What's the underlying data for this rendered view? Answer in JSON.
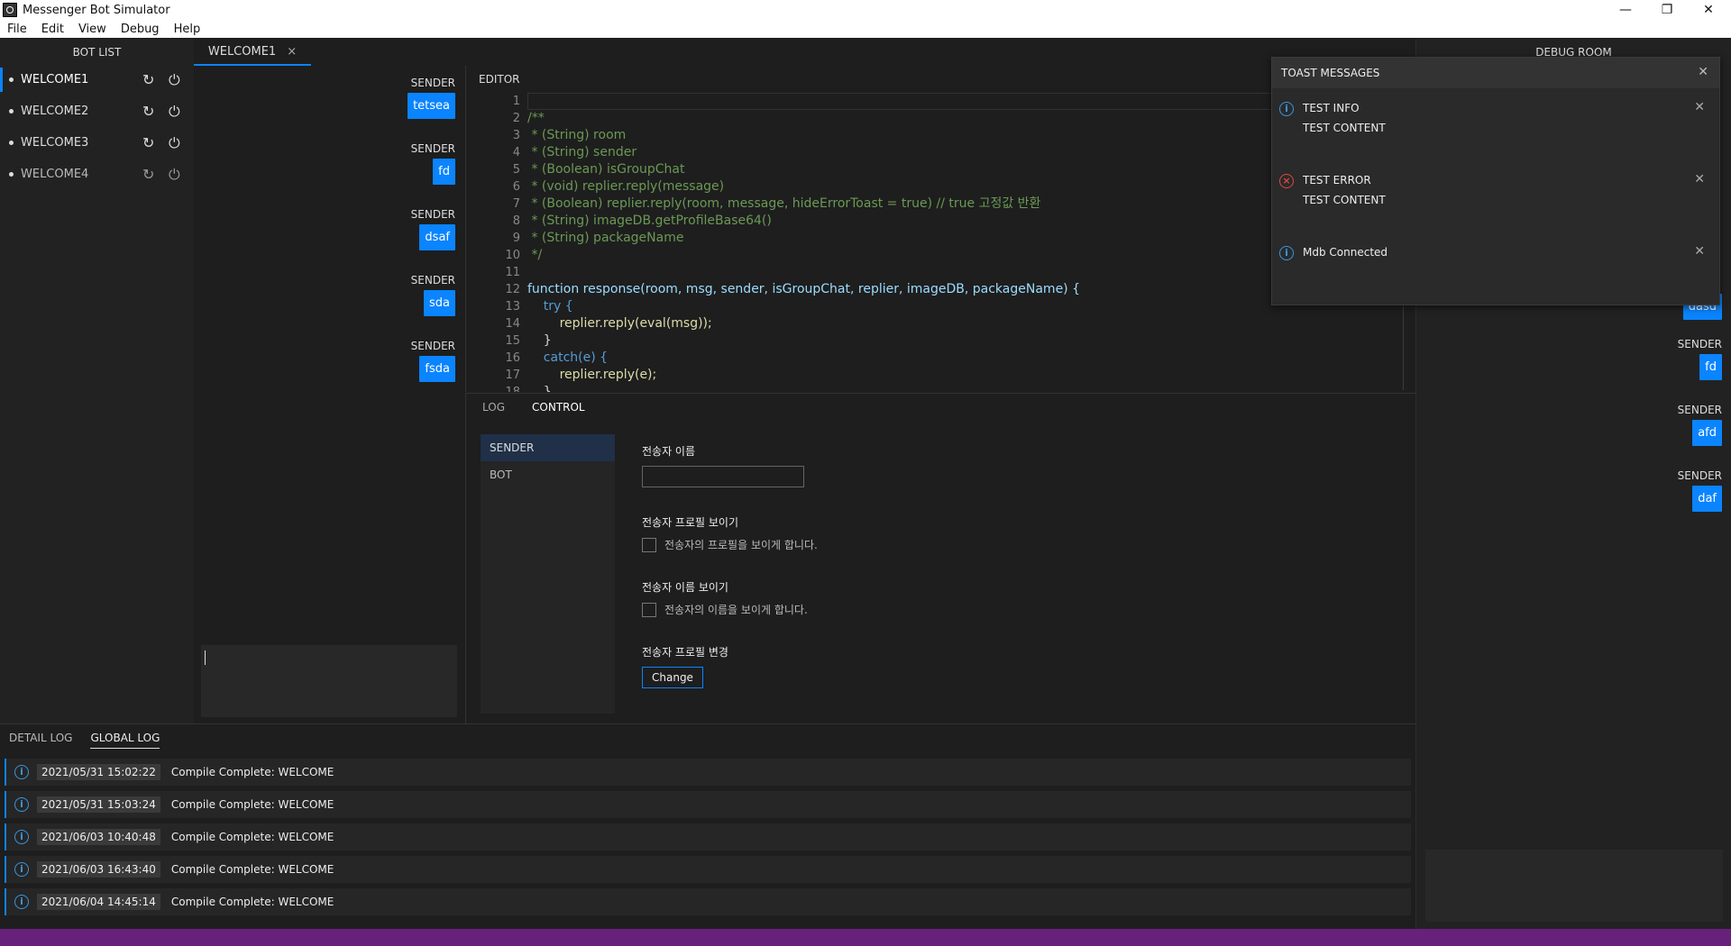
{
  "window": {
    "title": "Messenger Bot Simulator"
  },
  "menu": [
    "File",
    "Edit",
    "View",
    "Debug",
    "Help"
  ],
  "bot_list": {
    "title": "BOT LIST",
    "items": [
      {
        "label": "WELCOME1"
      },
      {
        "label": "WELCOME2"
      },
      {
        "label": "WELCOME3"
      },
      {
        "label": "WELCOME4"
      }
    ]
  },
  "tabs": [
    {
      "label": "WELCOME1",
      "close": "×"
    }
  ],
  "senders": {
    "label": "SENDER",
    "names": [
      "tetsea",
      "fd",
      "dsaf",
      "sda",
      "fsda"
    ]
  },
  "editor": {
    "title": "EDITOR",
    "lines": [
      "",
      "/**",
      " * (String) room",
      " * (String) sender",
      " * (Boolean) isGroupChat",
      " * (void) replier.reply(message)",
      " * (Boolean) replier.reply(room, message, hideErrorToast = true) // true 고정값 반환",
      " * (String) imageDB.getProfileBase64()",
      " * (String) packageName",
      " */",
      "",
      "function response(room, msg, sender, isGroupChat, replier, imageDB, packageName) {",
      "    try {",
      "        replier.reply(eval(msg));",
      "    }",
      "    catch(e) {",
      "        replier.reply(e);",
      "    }"
    ]
  },
  "control": {
    "tabs": [
      "LOG",
      "CONTROL"
    ],
    "side": [
      "SENDER",
      "BOT"
    ],
    "fields": {
      "sender_name_label": "전송자 이름",
      "sender_name_value": "",
      "show_profile_label": "전송자 프로필 보이기",
      "show_profile_desc": "전송자의 프로필을 보이게 합니다.",
      "show_name_label": "전송자 이름 보이기",
      "show_name_desc": "전송자의 이름을 보이게 합니다.",
      "change_profile_label": "전송자 프로필 변경",
      "change_button": "Change"
    }
  },
  "debug_room": {
    "title": "DEBUG ROOM",
    "partial_chip": "dasd",
    "senders": [
      "fd",
      "afd",
      "daf"
    ]
  },
  "toast": {
    "title": "TOAST MESSAGES",
    "items": [
      {
        "type": "info",
        "title": "TEST INFO",
        "content": "TEST CONTENT"
      },
      {
        "type": "error",
        "title": "TEST ERROR",
        "content": "TEST CONTENT"
      },
      {
        "type": "info",
        "title": "Mdb Connected",
        "content": ""
      }
    ]
  },
  "log": {
    "tabs": [
      "DETAIL LOG",
      "GLOBAL LOG"
    ],
    "rows": [
      {
        "time": "2021/05/31 15:02:22",
        "msg": "Compile Complete: WELCOME"
      },
      {
        "time": "2021/05/31 15:03:24",
        "msg": "Compile Complete: WELCOME"
      },
      {
        "time": "2021/06/03 10:40:48",
        "msg": "Compile Complete: WELCOME"
      },
      {
        "time": "2021/06/03 16:43:40",
        "msg": "Compile Complete: WELCOME"
      },
      {
        "time": "2021/06/04 14:45:14",
        "msg": "Compile Complete: WELCOME"
      }
    ]
  },
  "colors": {
    "accent": "#0a84ff",
    "statusbar": "#68217a",
    "error": "#e0483f"
  }
}
